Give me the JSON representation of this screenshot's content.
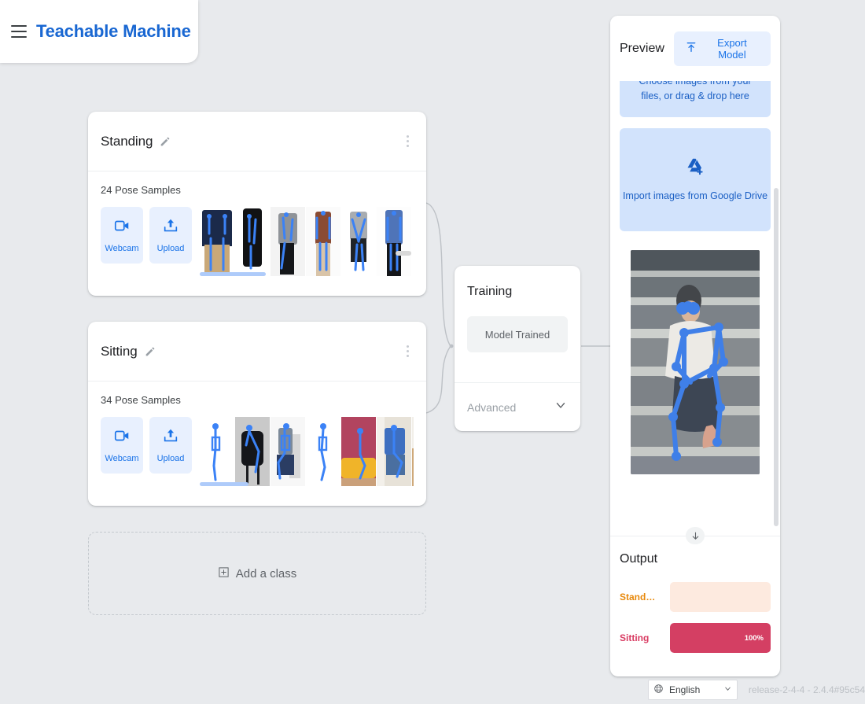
{
  "header": {
    "menu_icon": "hamburger-icon",
    "title": "Teachable Machine",
    "brand_color": "#1967d2"
  },
  "classes": [
    {
      "name": "Standing",
      "samples_label": "24 Pose Samples",
      "sample_count": 24,
      "edit_icon": "pencil-icon",
      "menu_icon": "kebab-menu-icon",
      "webcam_label": "Webcam",
      "webcam_icon": "video-camera-icon",
      "upload_label": "Upload",
      "upload_icon": "upload-arrow-icon",
      "thumbnails": [
        {
          "bg": "#ffffff",
          "body": "#1b2a4a",
          "legs": "#c9a878",
          "pose": "standing-front"
        },
        {
          "bg": "#ffffff",
          "body": "#111214",
          "legs": "#1a1a1c",
          "pose": "standing-side"
        },
        {
          "bg": "#f3f3f3",
          "body": "#8f9398",
          "legs": "#15171a",
          "pose": "standing-walk"
        },
        {
          "bg": "#fbfbfb",
          "body": "#8a4b33",
          "legs": "#d9c4a8",
          "pose": "standing-front"
        },
        {
          "bg": "#ffffff",
          "body": "#a8acb0",
          "legs": "#1f2328",
          "pose": "standing-front"
        },
        {
          "bg": "#fdfdfd",
          "body": "#4f74b8",
          "legs": "#14161a",
          "pose": "standing-front"
        },
        {
          "bg": "#ffffff",
          "body": "#eef1f4",
          "legs": "#213056",
          "pose": "standing-front"
        }
      ]
    },
    {
      "name": "Sitting",
      "samples_label": "34 Pose Samples",
      "sample_count": 34,
      "edit_icon": "pencil-icon",
      "menu_icon": "kebab-menu-icon",
      "webcam_label": "Webcam",
      "webcam_icon": "video-camera-icon",
      "upload_label": "Upload",
      "upload_icon": "upload-arrow-icon",
      "thumbnails": [
        {
          "bg": "#ffffff",
          "body": "#5a86c8",
          "legs": "#5a86c8",
          "pose": "sitting-side"
        },
        {
          "bg": "#c9c9c9",
          "body": "#15161a",
          "legs": "#1b1c20",
          "pose": "sitting-stool"
        },
        {
          "bg": "#f7f7f7",
          "body": "#7d8a99",
          "legs": "#2b3d63",
          "pose": "sitting-chair"
        },
        {
          "bg": "#ffffff",
          "body": "#4a7bc4",
          "legs": "#4a7bc4",
          "pose": "sitting-side"
        },
        {
          "bg": "#b2445f",
          "body": "#9aa3ad",
          "legs": "#c8ccd1",
          "pose": "sitting-couch"
        },
        {
          "bg": "#e7e2d8",
          "body": "#3e6fc0",
          "legs": "#4a6fa0",
          "pose": "sitting-stairs"
        },
        {
          "bg": "#cfa97a",
          "body": "#6f4a3a",
          "legs": "#f0f0f0",
          "pose": "sitting-floor"
        }
      ]
    }
  ],
  "add_class": {
    "label": "Add a class",
    "icon": "plus-square-icon"
  },
  "training": {
    "title": "Training",
    "train_button_label": "Model Trained",
    "advanced_label": "Advanced",
    "chevron_icon": "chevron-down-icon"
  },
  "preview": {
    "title": "Preview",
    "export_label": "Export Model",
    "export_icon": "export-upload-icon",
    "dropzone_text": "Choose images from your files, or drag & drop here",
    "gdrive_label": "Import images from Google Drive",
    "gdrive_icon": "google-drive-plus-icon",
    "preview_image_alt": "person sitting on stone stairs with pose skeleton overlay",
    "scroll_down_icon": "arrow-down-icon"
  },
  "output": {
    "title": "Output",
    "rows": [
      {
        "label": "Stand…",
        "full_label": "Standing",
        "percent": 0,
        "percent_label": "",
        "label_color": "#e8890c",
        "bar_color": "#fdeadf",
        "track_color": "#fdeadf"
      },
      {
        "label": "Sitting",
        "percent": 100,
        "percent_label": "100%",
        "label_color": "#d93b62",
        "bar_color": "#d43f63",
        "track_color": "#fbe3e9"
      }
    ]
  },
  "footer": {
    "language": "English",
    "language_icon": "globe-icon",
    "caret_icon": "chevron-down-icon",
    "version": "release-2-4-4 - 2.4.4#95c54"
  }
}
